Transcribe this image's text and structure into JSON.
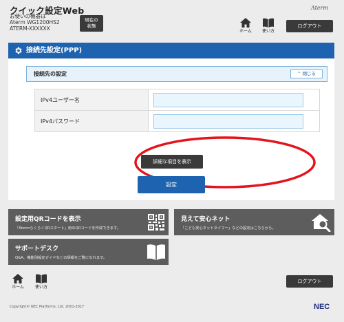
{
  "header": {
    "app_title": "クイック設定Web",
    "model_lines": [
      "お使いの機器は",
      "Aterm WG1200HS2",
      "ATERM-XXXXXX"
    ],
    "status_button": [
      "現在の",
      "状態"
    ],
    "brand": "Aterm",
    "home_label": "ホーム",
    "manual_label": "使い方",
    "logout_label": "ログアウト"
  },
  "main": {
    "section_title": "接続先設定(PPP)",
    "subsection_title": "接続先の設定",
    "close_label": "閉じる",
    "fields": [
      {
        "label": "IPv4ユーザー名",
        "value": ""
      },
      {
        "label": "IPv4パスワード",
        "value": ""
      }
    ],
    "detail_button": "詳細な項目を表示",
    "submit_button": "設定"
  },
  "tiles": {
    "qr": {
      "title": "設定用QRコードを表示",
      "desc": "「AtermらくらくQRスタート」用のQRコードを作成できます。"
    },
    "safe": {
      "title": "見えて安心ネット",
      "desc": "「こども安心ネットタイマー」などの設定はこちらから。"
    },
    "support": {
      "title": "サポートデスク",
      "desc": "Q&A、機能別設定ガイドなどの情報をご覧になれます。"
    }
  },
  "footer": {
    "home_label": "ホーム",
    "manual_label": "使い方",
    "logout_label": "ログアウト",
    "copyright": "Copyright© NEC Platforms, Ltd. 2001-2017",
    "logo": "NEC"
  },
  "colors": {
    "accent": "#1e63b0",
    "dark_button": "#3a3a3a",
    "tile": "#5d5d5d",
    "annotation": "#e3141b"
  }
}
